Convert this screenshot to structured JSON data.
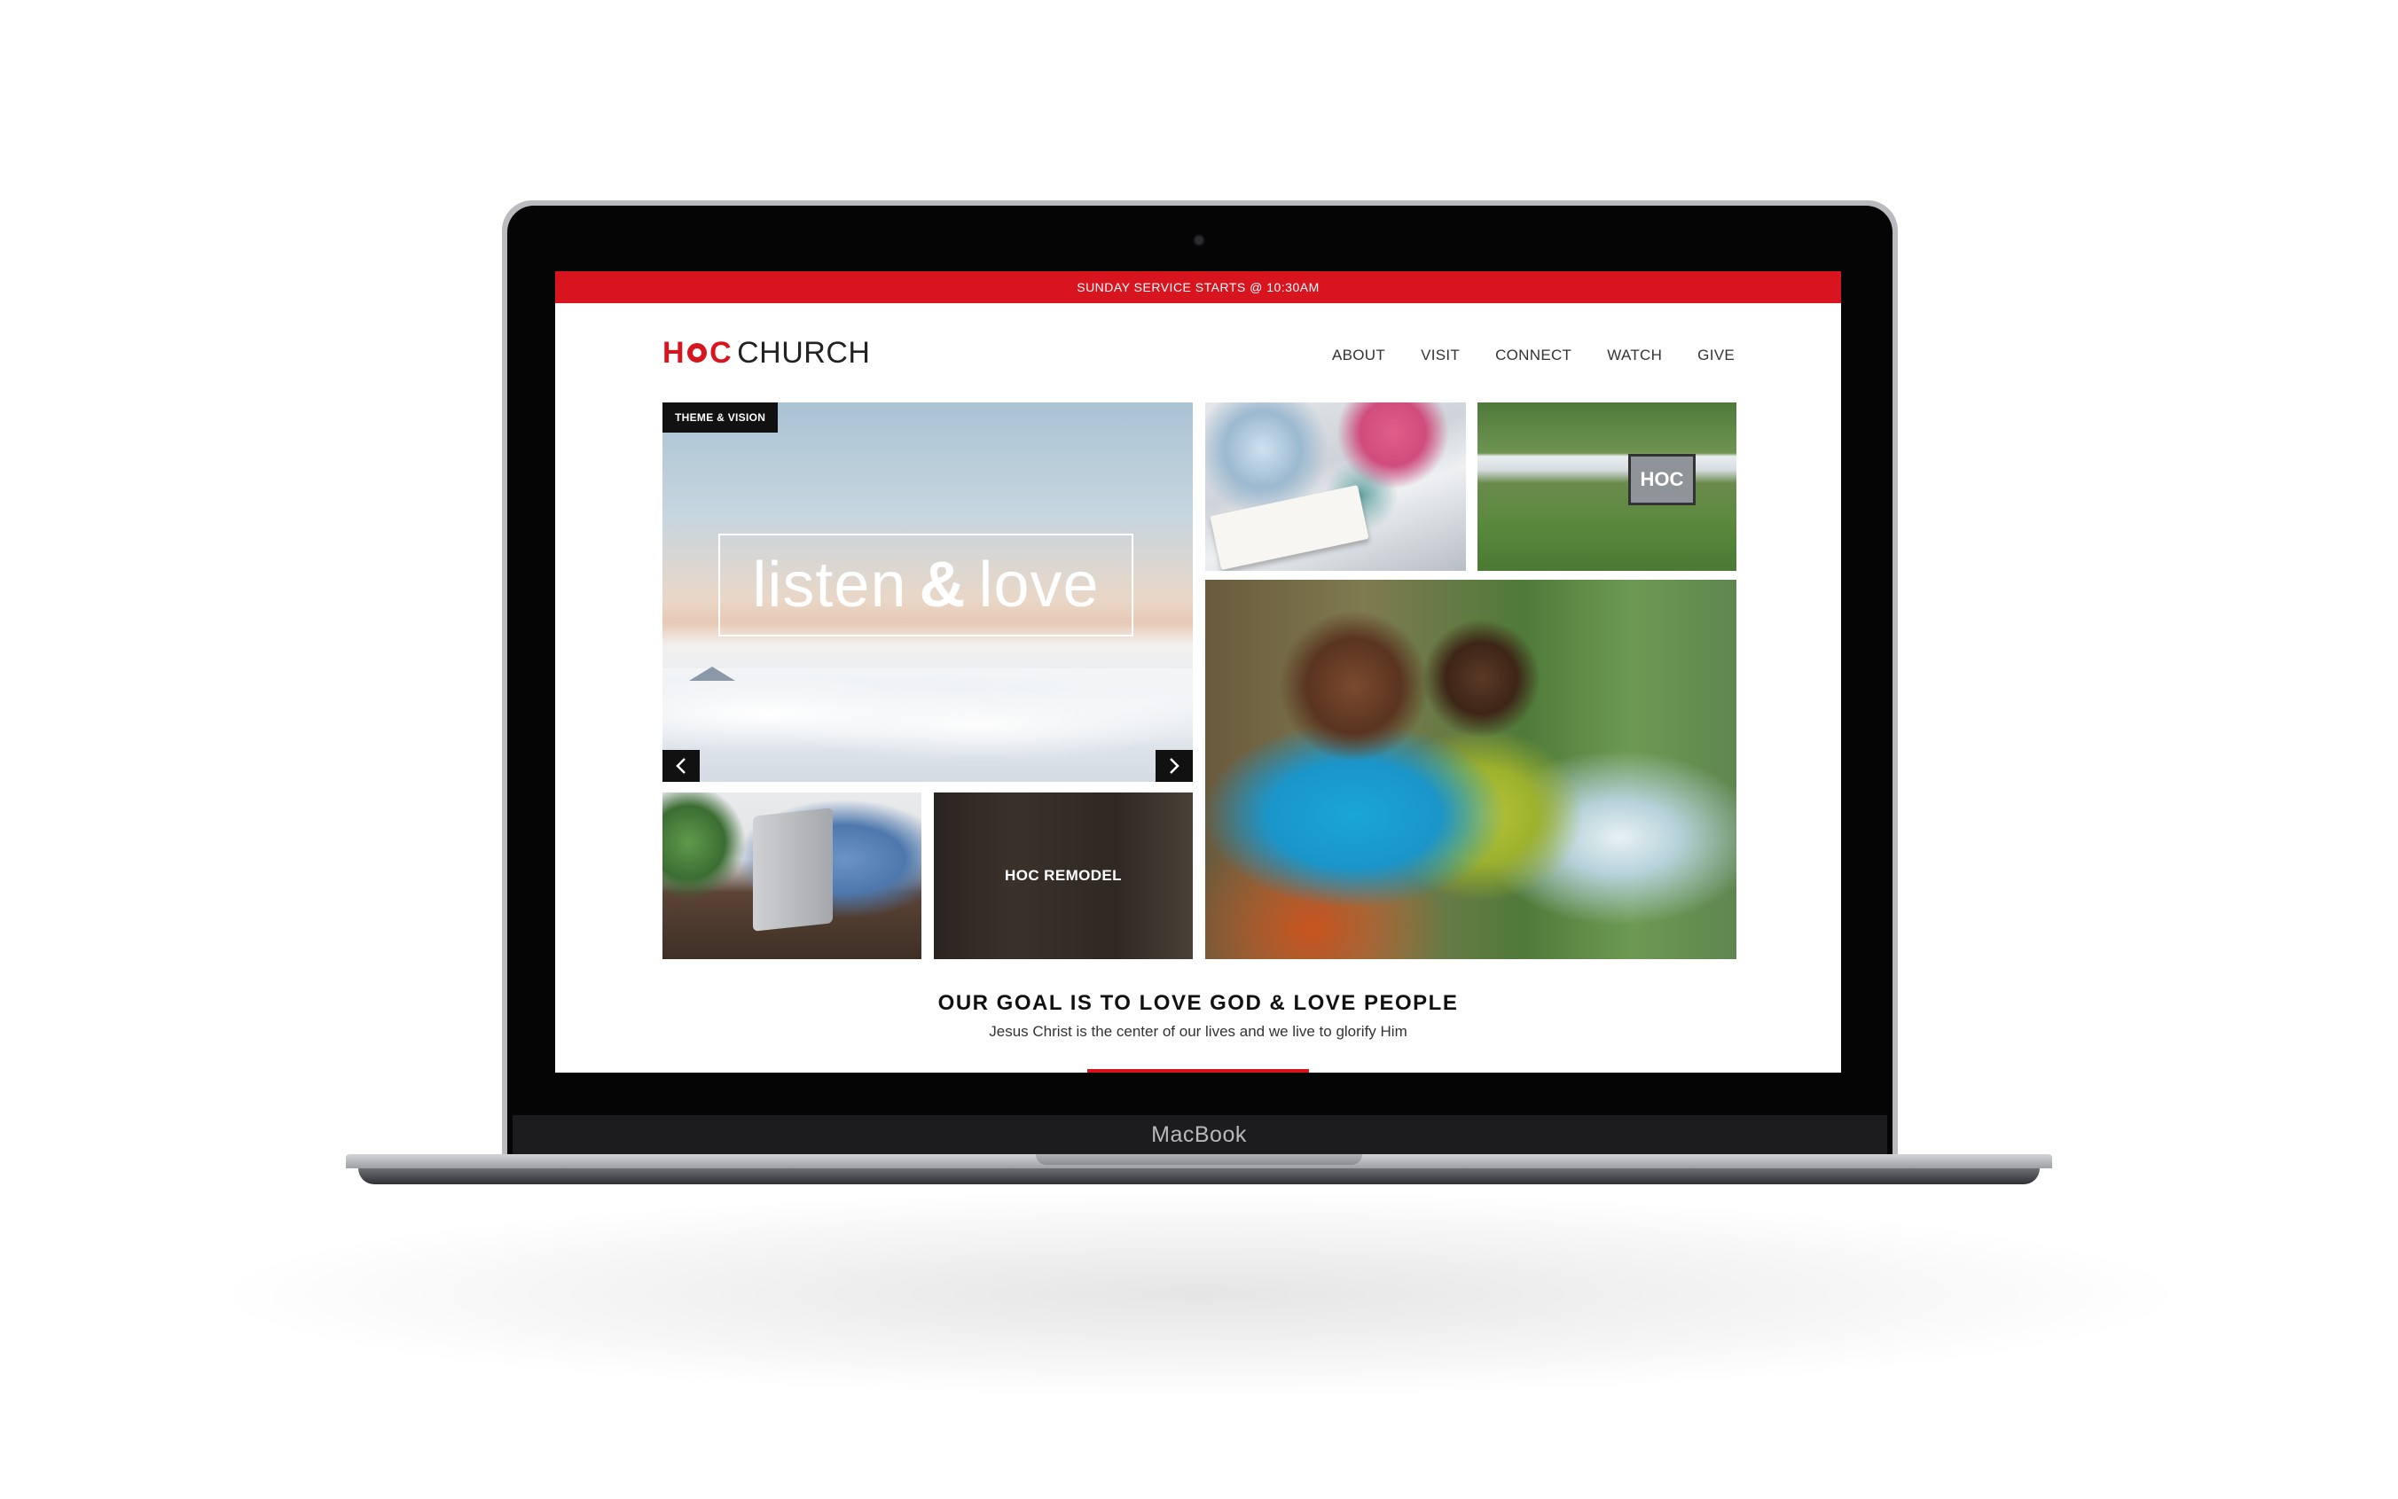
{
  "device": {
    "label": "MacBook"
  },
  "site": {
    "announcement": "SUNDAY SERVICE STARTS @ 10:30AM",
    "logo": {
      "brand": "HOC",
      "brand_h": "H",
      "brand_c": "C",
      "name": "CHURCH"
    },
    "nav": [
      "ABOUT",
      "VISIT",
      "CONNECT",
      "WATCH",
      "GIVE"
    ],
    "hero": {
      "tag": "THEME & VISION",
      "word1": "listen",
      "amp": "&",
      "word2": "love",
      "prev_icon": "chevron-left-icon",
      "next_icon": "chevron-right-icon"
    },
    "tiles": {
      "sign_text": "HOC",
      "remodel_label": "HOC REMODEL"
    },
    "goal": {
      "heading": "OUR GOAL IS TO LOVE GOD & LOVE PEOPLE",
      "subtext": "Jesus Christ is the center of our lives and we live to glorify Him"
    }
  },
  "colors": {
    "accent": "#d8141f",
    "dark": "#111111"
  }
}
